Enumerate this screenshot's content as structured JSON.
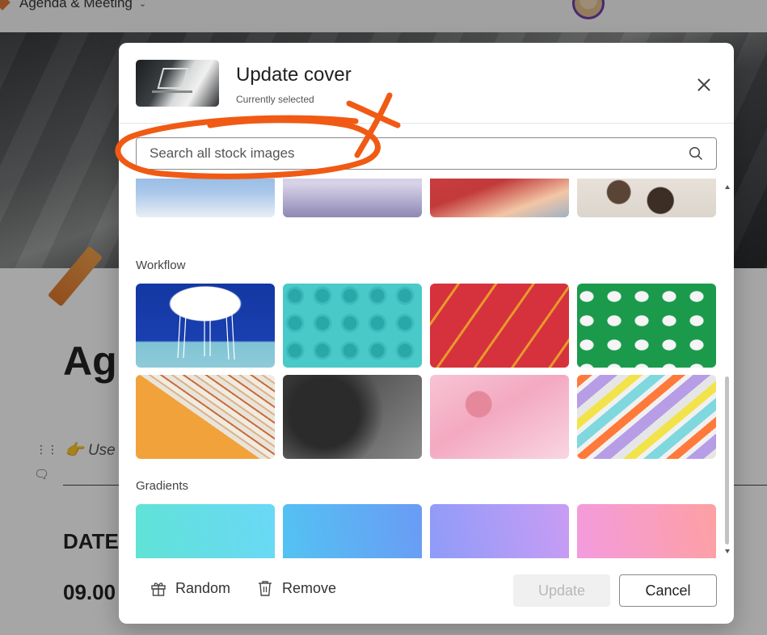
{
  "background": {
    "app_title": "Agenda & Meeting",
    "heading": "Ag",
    "instruction": "Use",
    "date_label": "DATE",
    "time_label": "09.00"
  },
  "modal": {
    "title": "Update cover",
    "subtitle": "Currently selected",
    "search": {
      "placeholder": "Search all stock images",
      "value": ""
    },
    "sections": [
      {
        "label": "Workflow"
      },
      {
        "label": "Gradients"
      }
    ],
    "footer": {
      "random_label": "Random",
      "remove_label": "Remove",
      "update_label": "Update",
      "cancel_label": "Cancel"
    }
  },
  "colors": {
    "annotation": "#f05a14",
    "avatar_ring": "#6d3fb0",
    "gradient_1": [
      "#5fe3d4",
      "#6ad8f7"
    ],
    "gradient_2": [
      "#52c4f2",
      "#6a9bf5"
    ],
    "gradient_3": [
      "#8c9cf9",
      "#c99cf4"
    ],
    "gradient_4": [
      "#f39be0",
      "#fda0a3"
    ]
  },
  "icons": [
    "search-icon",
    "close-icon",
    "gift-icon",
    "trash-icon",
    "chevron-down-icon"
  ]
}
